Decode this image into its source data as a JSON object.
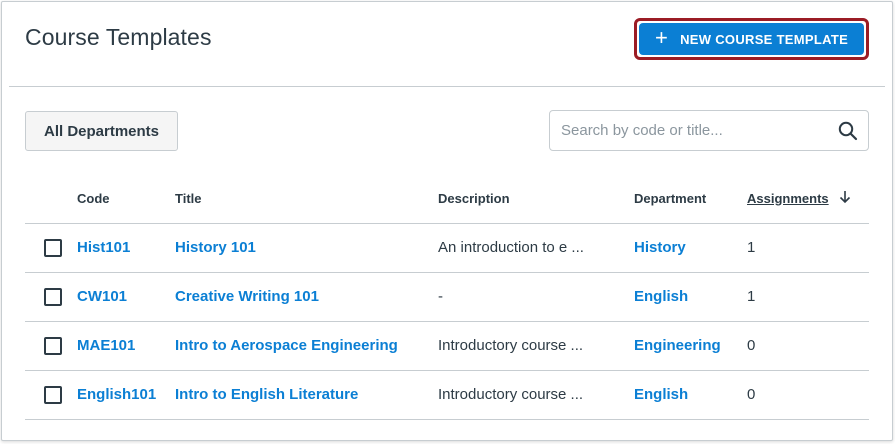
{
  "header": {
    "title": "Course Templates",
    "new_button_label": "NEW COURSE TEMPLATE"
  },
  "filters": {
    "department_label": "All Departments",
    "search_placeholder": "Search by code or title..."
  },
  "table": {
    "columns": {
      "code": "Code",
      "title": "Title",
      "description": "Description",
      "department": "Department",
      "assignments": "Assignments"
    },
    "sort": {
      "column": "assignments",
      "direction": "descending"
    },
    "rows": [
      {
        "code": "Hist101",
        "title": "History 101",
        "description": "An introduction to e ...",
        "department": "History",
        "assignments": "1"
      },
      {
        "code": "CW101",
        "title": "Creative Writing 101",
        "description": "-",
        "department": "English",
        "assignments": "1"
      },
      {
        "code": "MAE101",
        "title": "Intro to Aerospace Engineering",
        "description": "Introductory course ...",
        "department": "Engineering",
        "assignments": "0"
      },
      {
        "code": "English101",
        "title": "Intro to English Literature",
        "description": "Introductory course ...",
        "department": "English",
        "assignments": "0"
      }
    ]
  },
  "colors": {
    "primary": "#0b7fd4",
    "focus_ring": "#9b1c25",
    "text": "#2d3b45",
    "border": "#c7cdd1"
  },
  "icons": {
    "new_button": "plus-icon",
    "search": "search-icon",
    "sort": "arrow-down-icon",
    "row_select": "checkbox"
  }
}
